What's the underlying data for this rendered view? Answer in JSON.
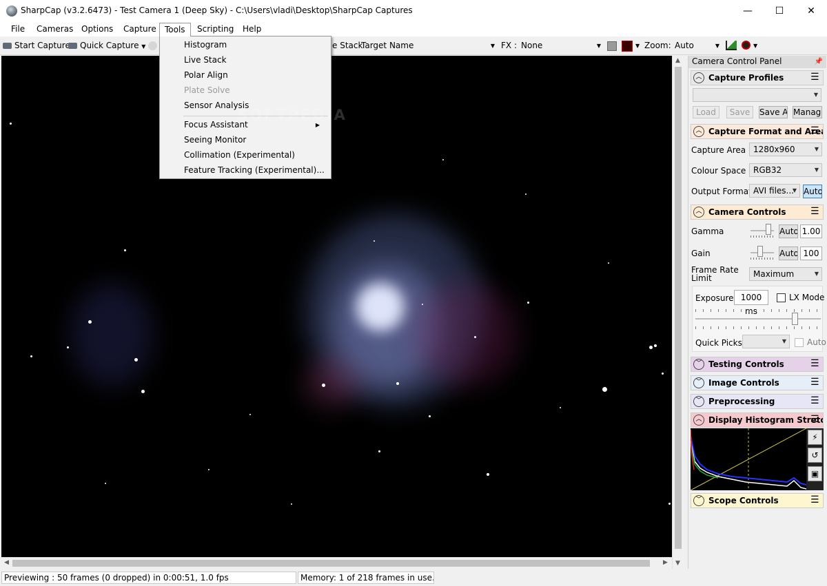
{
  "window": {
    "title": "SharpCap (v3.2.6473) - Test Camera 1 (Deep Sky) - C:\\Users\\vladi\\Desktop\\SharpCap Captures",
    "minimize": "—",
    "maximize": "☐",
    "close": "✕"
  },
  "menu": [
    "File",
    "Cameras",
    "Options",
    "Capture",
    "Tools",
    "Scripting",
    "Help"
  ],
  "tools_menu": {
    "items": [
      {
        "label": "Histogram",
        "enabled": true
      },
      {
        "label": "Live Stack",
        "enabled": true
      },
      {
        "label": "Polar Align",
        "enabled": true
      },
      {
        "label": "Plate Solve",
        "enabled": false
      },
      {
        "label": "Sensor Analysis",
        "enabled": true
      },
      {
        "label": "Focus Assistant",
        "enabled": true,
        "submenu": true
      },
      {
        "label": "Seeing Monitor",
        "enabled": true
      },
      {
        "label": "Collimation (Experimental)",
        "enabled": true
      },
      {
        "label": "Feature Tracking (Experimental)...",
        "enabled": true
      }
    ]
  },
  "toolbar": {
    "start_capture": "Start Capture",
    "quick_capture": "Quick Capture",
    "stack": "e Stack",
    "target_name_label": "Target Name :",
    "fx_label": "FX :",
    "fx_value": "None",
    "zoom_label": "Zoom:",
    "zoom_value": "Auto"
  },
  "watermark": "SOFTPEDIA",
  "status": {
    "preview": "Previewing : 50 frames (0 dropped) in 0:00:51, 1.0 fps",
    "memory": "Memory: 1 of 218 frames in use."
  },
  "panel": {
    "title": "Camera Control Panel",
    "capture_profiles": {
      "title": "Capture Profiles",
      "buttons": [
        "Load",
        "Save",
        "Save As",
        "Manage"
      ]
    },
    "capture_format": {
      "title": "Capture Format and Area",
      "capture_area_label": "Capture Area",
      "capture_area_value": "1280x960",
      "colour_space_label": "Colour Space",
      "colour_space_value": "RGB32",
      "output_format_label": "Output Format",
      "output_format_value": "AVI files...",
      "auto_button": "Auto"
    },
    "camera_controls": {
      "title": "Camera Controls",
      "gamma_label": "Gamma",
      "gamma_auto": "Auto",
      "gamma_value": "1.00",
      "gain_label": "Gain",
      "gain_auto": "Auto",
      "gain_value": "100",
      "frame_rate_label_1": "Frame Rate",
      "frame_rate_label_2": "Limit",
      "frame_rate_value": "Maximum",
      "exposure_label": "Exposure",
      "exposure_value": "1000 ms",
      "lx_mode_label": "LX Mode",
      "quick_picks_label": "Quick Picks",
      "auto_label": "Auto"
    },
    "sections": {
      "testing": "Testing Controls",
      "image": "Image Controls",
      "preprocessing": "Preprocessing",
      "histogram": "Display Histogram Stretch",
      "scope": "Scope Controls"
    },
    "section_colors": {
      "profiles": "#e8e8e8",
      "format": "#fde9d9",
      "camera": "#fdebd3",
      "testing": "#e5d2e8",
      "image": "#e6eef8",
      "preprocessing": "#e6e6f6",
      "histogram": "#f6c9cf",
      "scope": "#fdf6cf"
    }
  }
}
